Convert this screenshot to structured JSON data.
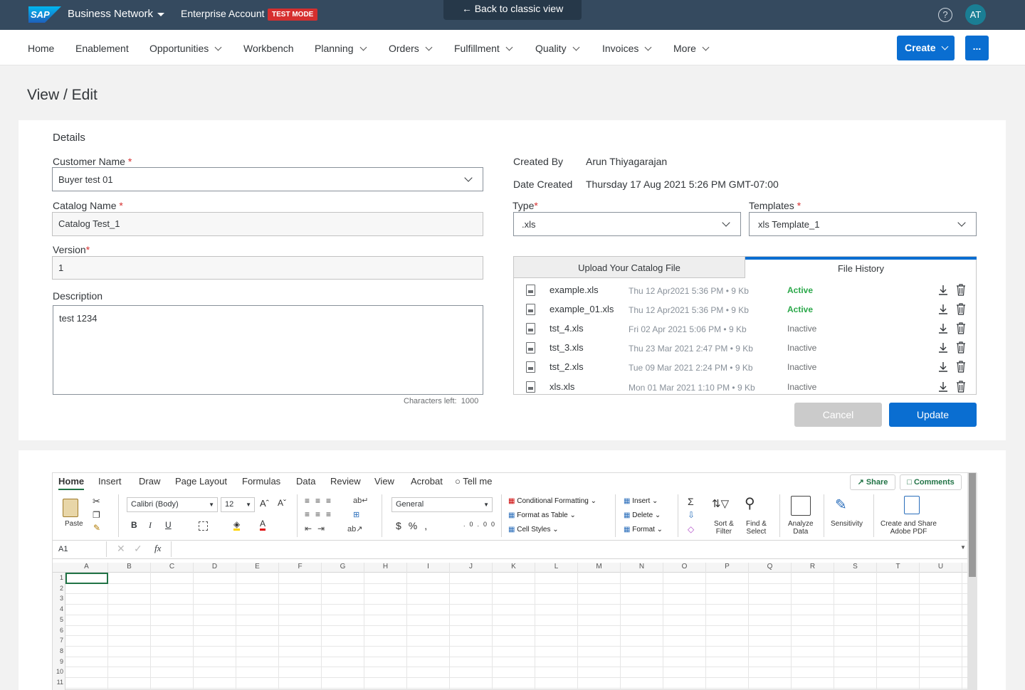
{
  "shell": {
    "logo": "SAP",
    "product": "Business Network",
    "account": "Enterprise Account",
    "mode_badge": "TEST MODE",
    "back_link": "Back to classic view",
    "help": "?",
    "avatar": "AT"
  },
  "nav": {
    "items": [
      "Home",
      "Enablement",
      "Opportunities",
      "Workbench",
      "Planning",
      "Orders",
      "Fulfillment",
      "Quality",
      "Invoices",
      "More"
    ],
    "create": "Create",
    "more": "..."
  },
  "page": {
    "title": "View / Edit"
  },
  "details": {
    "section_title": "Details",
    "customer_name": {
      "label": "Customer Name",
      "required": "*",
      "value": "Buyer test 01"
    },
    "catalog_name": {
      "label": "Catalog Name",
      "required": "*",
      "value": "Catalog Test_1"
    },
    "version": {
      "label": "Version",
      "required": "*",
      "value": "1"
    },
    "description": {
      "label": "Description",
      "value": "test 1234",
      "chars_left_label": "Characters left:",
      "chars_left": "1000"
    },
    "created_by": {
      "label": "Created By",
      "value": "Arun Thiyagarajan"
    },
    "date_created": {
      "label": "Date Created",
      "value": "Thursday 17 Aug 2021 5:26 PM GMT-07:00"
    },
    "type": {
      "label": "Type",
      "required": "*",
      "value": ".xls"
    },
    "templates": {
      "label": "Templates",
      "required": "*",
      "value": "xls Template_1"
    }
  },
  "file_tabs": {
    "upload_tab": "Upload Your Catalog File",
    "history_tab": "File History",
    "files": [
      {
        "name": "example.xls",
        "meta": "Thu 12 Apr2021 5:36 PM • 9 Kb",
        "status": "Active"
      },
      {
        "name": "example_01.xls",
        "meta": "Thu 12 Apr2021 5:36 PM • 9 Kb",
        "status": "Active"
      },
      {
        "name": "tst_4.xls",
        "meta": "Fri 02 Apr 2021 5:06 PM • 9 Kb",
        "status": "Inactive"
      },
      {
        "name": "tst_3.xls",
        "meta": "Thu 23 Mar 2021 2:47 PM • 9 Kb",
        "status": "Inactive"
      },
      {
        "name": "tst_2.xls",
        "meta": "Tue 09 Mar 2021 2:24 PM • 9 Kb",
        "status": "Inactive"
      },
      {
        "name": "xls.xls",
        "meta": "Mon 01 Mar 2021 1:10 PM • 9 Kb",
        "status": "Inactive"
      }
    ]
  },
  "actions": {
    "cancel": "Cancel",
    "update": "Update"
  },
  "excel": {
    "tabs": [
      "Home",
      "Insert",
      "Draw",
      "Page Layout",
      "Formulas",
      "Data",
      "Review",
      "View",
      "Acrobat",
      "Tell me"
    ],
    "share": "Share",
    "comments": "Comments",
    "paste": "Paste",
    "font": "Calibri (Body)",
    "font_size": "12",
    "number_format": "General",
    "bold": "B",
    "italic": "I",
    "underline": "U",
    "styles": [
      "Conditional Formatting",
      "Format as Table",
      "Cell Styles"
    ],
    "cells": [
      "Insert",
      "Delete",
      "Format"
    ],
    "sort_filter": [
      "Sort &",
      "Filter"
    ],
    "find_select": [
      "Find &",
      "Select"
    ],
    "analyze": [
      "Analyze",
      "Data"
    ],
    "sensitivity": "Sensitivity",
    "adobe": [
      "Create and Share",
      "Adobe PDF"
    ],
    "name_box": "A1",
    "fx": "fx",
    "columns": [
      "A",
      "B",
      "C",
      "D",
      "E",
      "F",
      "G",
      "H",
      "I",
      "J",
      "K",
      "L",
      "M",
      "N",
      "O",
      "P",
      "Q",
      "R",
      "S",
      "T",
      "U"
    ],
    "rows": [
      "1",
      "2",
      "3",
      "4",
      "5",
      "6",
      "7",
      "8",
      "9",
      "10",
      "11"
    ]
  }
}
